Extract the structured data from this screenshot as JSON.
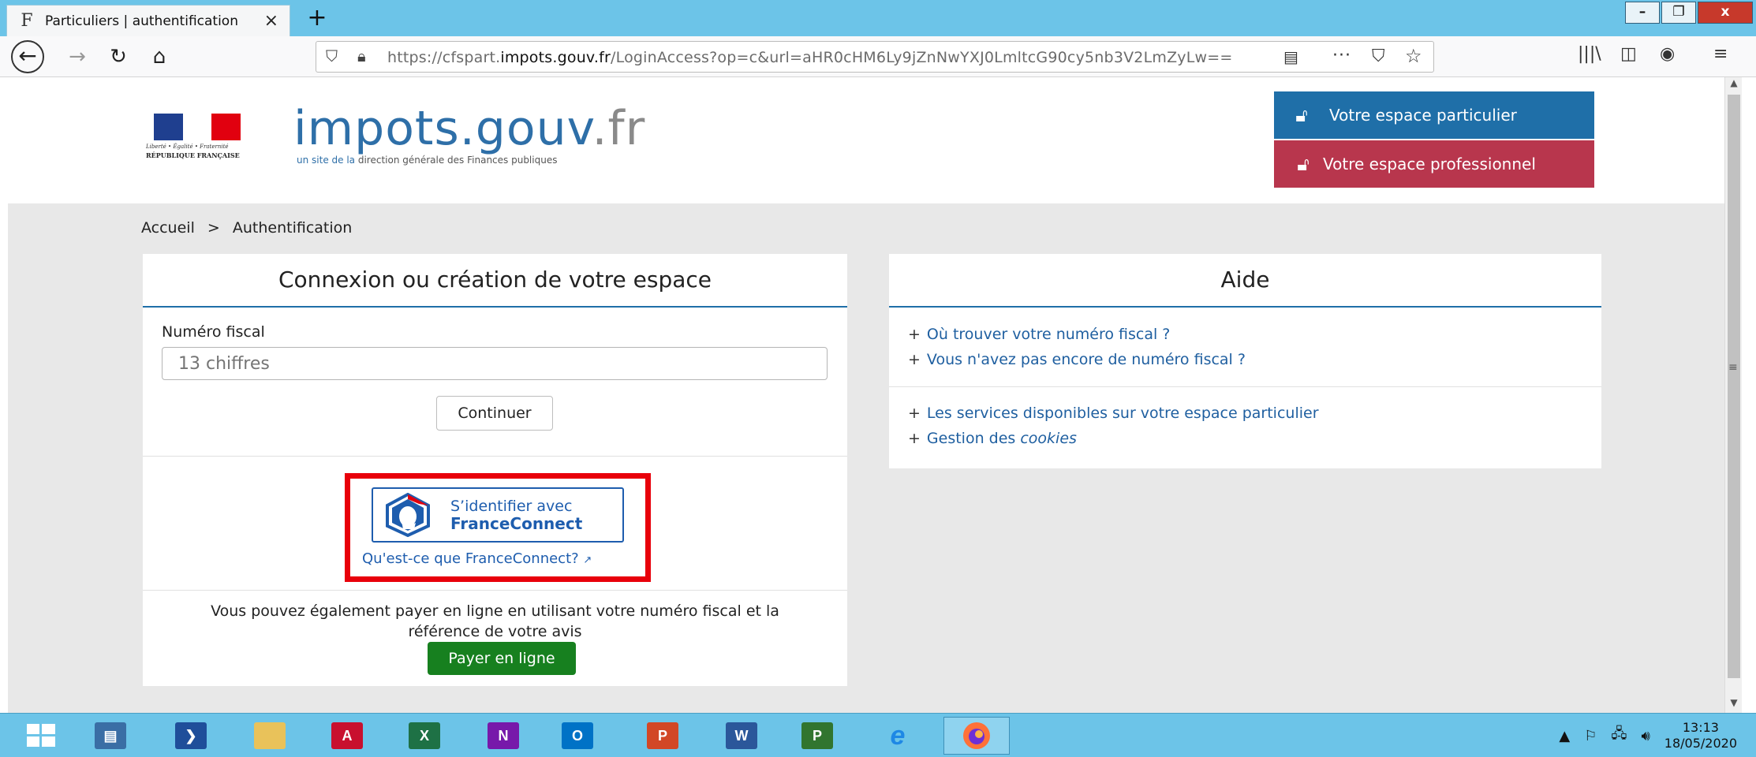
{
  "browser": {
    "tab_title": "Particuliers | authentification",
    "tab_favicon": "F",
    "new_tab": "+",
    "url_prefix": "https://cfspart.",
    "url_domain": "impots.gouv.fr",
    "url_rest": "/LoginAccess?op=c&url=aHR0cHM6Ly9jZnNwYXJ0LmltcG90cy5nb3V2LmZyLw==",
    "window_minimize": "–",
    "window_restore": "❐",
    "window_close": "x"
  },
  "header": {
    "motto": "Liberté • Égalité • Fraternité",
    "republic": "RÉPUBLIQUE FRANÇAISE",
    "brand_main": "impots.gouv",
    "brand_dom": ".fr",
    "tagline_a": "un site de la ",
    "tagline_b": "direction générale des Finances publiques",
    "btn_particulier": "Votre espace particulier",
    "btn_professionnel": "Votre espace professionnel"
  },
  "breadcrumb": {
    "home": "Accueil",
    "sep": ">",
    "current": "Authentification"
  },
  "login": {
    "title": "Connexion ou création de votre espace",
    "field_label": "Numéro fiscal",
    "field_placeholder": "13 chiffres",
    "continue": "Continuer",
    "fc_line1": "S’identifier avec",
    "fc_line2": "FranceConnect",
    "fc_what": "Qu'est-ce que FranceConnect?",
    "pay_text": "Vous pouvez également payer en ligne en utilisant votre numéro fiscal et la référence de votre avis",
    "pay_button": "Payer en ligne"
  },
  "aide": {
    "title": "Aide",
    "links": [
      "Où trouver votre numéro fiscal ?",
      "Vous n'avez pas encore de numéro fiscal ?",
      "Les services disponibles sur votre espace particulier",
      "Gestion des "
    ],
    "cookies_word": "cookies"
  },
  "taskbar": {
    "apps": [
      {
        "name": "server-manager",
        "label": ""
      },
      {
        "name": "powershell",
        "label": ""
      },
      {
        "name": "file-explorer",
        "label": ""
      },
      {
        "name": "acrobat",
        "label": "A"
      },
      {
        "name": "excel",
        "label": "X"
      },
      {
        "name": "onenote",
        "label": "N"
      },
      {
        "name": "outlook",
        "label": "O"
      },
      {
        "name": "powerpoint",
        "label": "P"
      },
      {
        "name": "word",
        "label": "W"
      },
      {
        "name": "project",
        "label": "P"
      },
      {
        "name": "internet-explorer",
        "label": "e"
      },
      {
        "name": "firefox",
        "label": ""
      }
    ],
    "time": "13:13",
    "date": "18/05/2020"
  },
  "colors": {
    "brand_blue": "#1f6fa8",
    "pro_red": "#b8364d",
    "pay_green": "#17801f",
    "highlight_red": "#e8000b",
    "taskbar": "#6cc4e8"
  }
}
